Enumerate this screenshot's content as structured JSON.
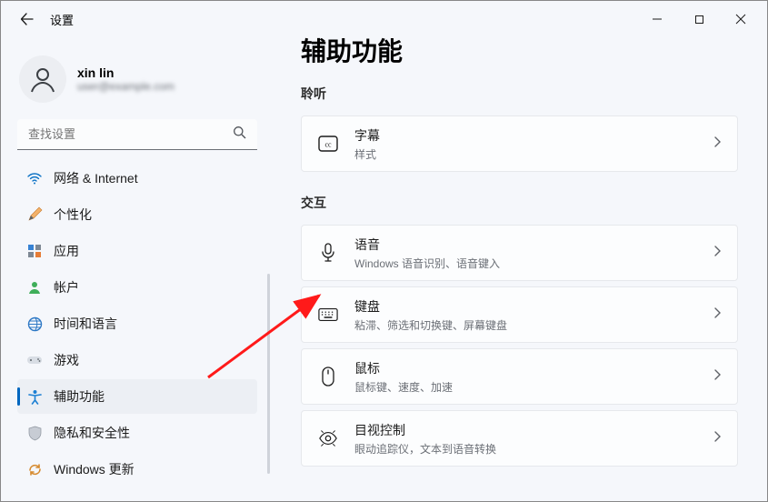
{
  "window": {
    "app_title": "设置"
  },
  "user": {
    "name": "xin lin",
    "email": "user@example.com"
  },
  "search": {
    "placeholder": "查找设置"
  },
  "sidebar": {
    "items": [
      {
        "label": "网络 & Internet",
        "icon": "wifi"
      },
      {
        "label": "个性化",
        "icon": "brush"
      },
      {
        "label": "应用",
        "icon": "apps"
      },
      {
        "label": "帐户",
        "icon": "account"
      },
      {
        "label": "时间和语言",
        "icon": "time-lang"
      },
      {
        "label": "游戏",
        "icon": "gaming"
      },
      {
        "label": "辅助功能",
        "icon": "accessibility"
      },
      {
        "label": "隐私和安全性",
        "icon": "privacy"
      },
      {
        "label": "Windows 更新",
        "icon": "update"
      }
    ]
  },
  "page": {
    "title": "辅助功能",
    "sections": [
      {
        "label": "聆听",
        "cards": [
          {
            "title": "字幕",
            "sub": "样式",
            "icon": "captions"
          }
        ]
      },
      {
        "label": "交互",
        "cards": [
          {
            "title": "语音",
            "sub": "Windows 语音识别、语音键入",
            "icon": "mic"
          },
          {
            "title": "键盘",
            "sub": "粘滞、筛选和切换键、屏幕键盘",
            "icon": "keyboard"
          },
          {
            "title": "鼠标",
            "sub": "鼠标键、速度、加速",
            "icon": "mouse"
          },
          {
            "title": "目视控制",
            "sub": "眼动追踪仪，文本到语音转换",
            "icon": "eye"
          }
        ]
      }
    ]
  }
}
